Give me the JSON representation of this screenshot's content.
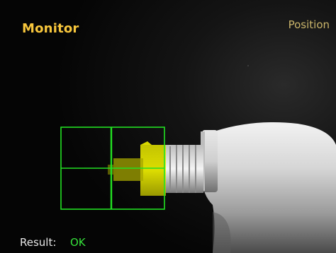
{
  "header": {
    "title": "Monitor",
    "mode": "Position"
  },
  "result": {
    "label": "Result:",
    "value": "OK"
  },
  "colors": {
    "title": "#f7c63c",
    "mode": "#c9b46a",
    "overlay": "#22e022",
    "highlight": "#e6e600",
    "ok": "#35e03a"
  },
  "icons": {
    "inspection_target": "tube-nozzle-image",
    "roi": "crosshair-roi-box"
  }
}
